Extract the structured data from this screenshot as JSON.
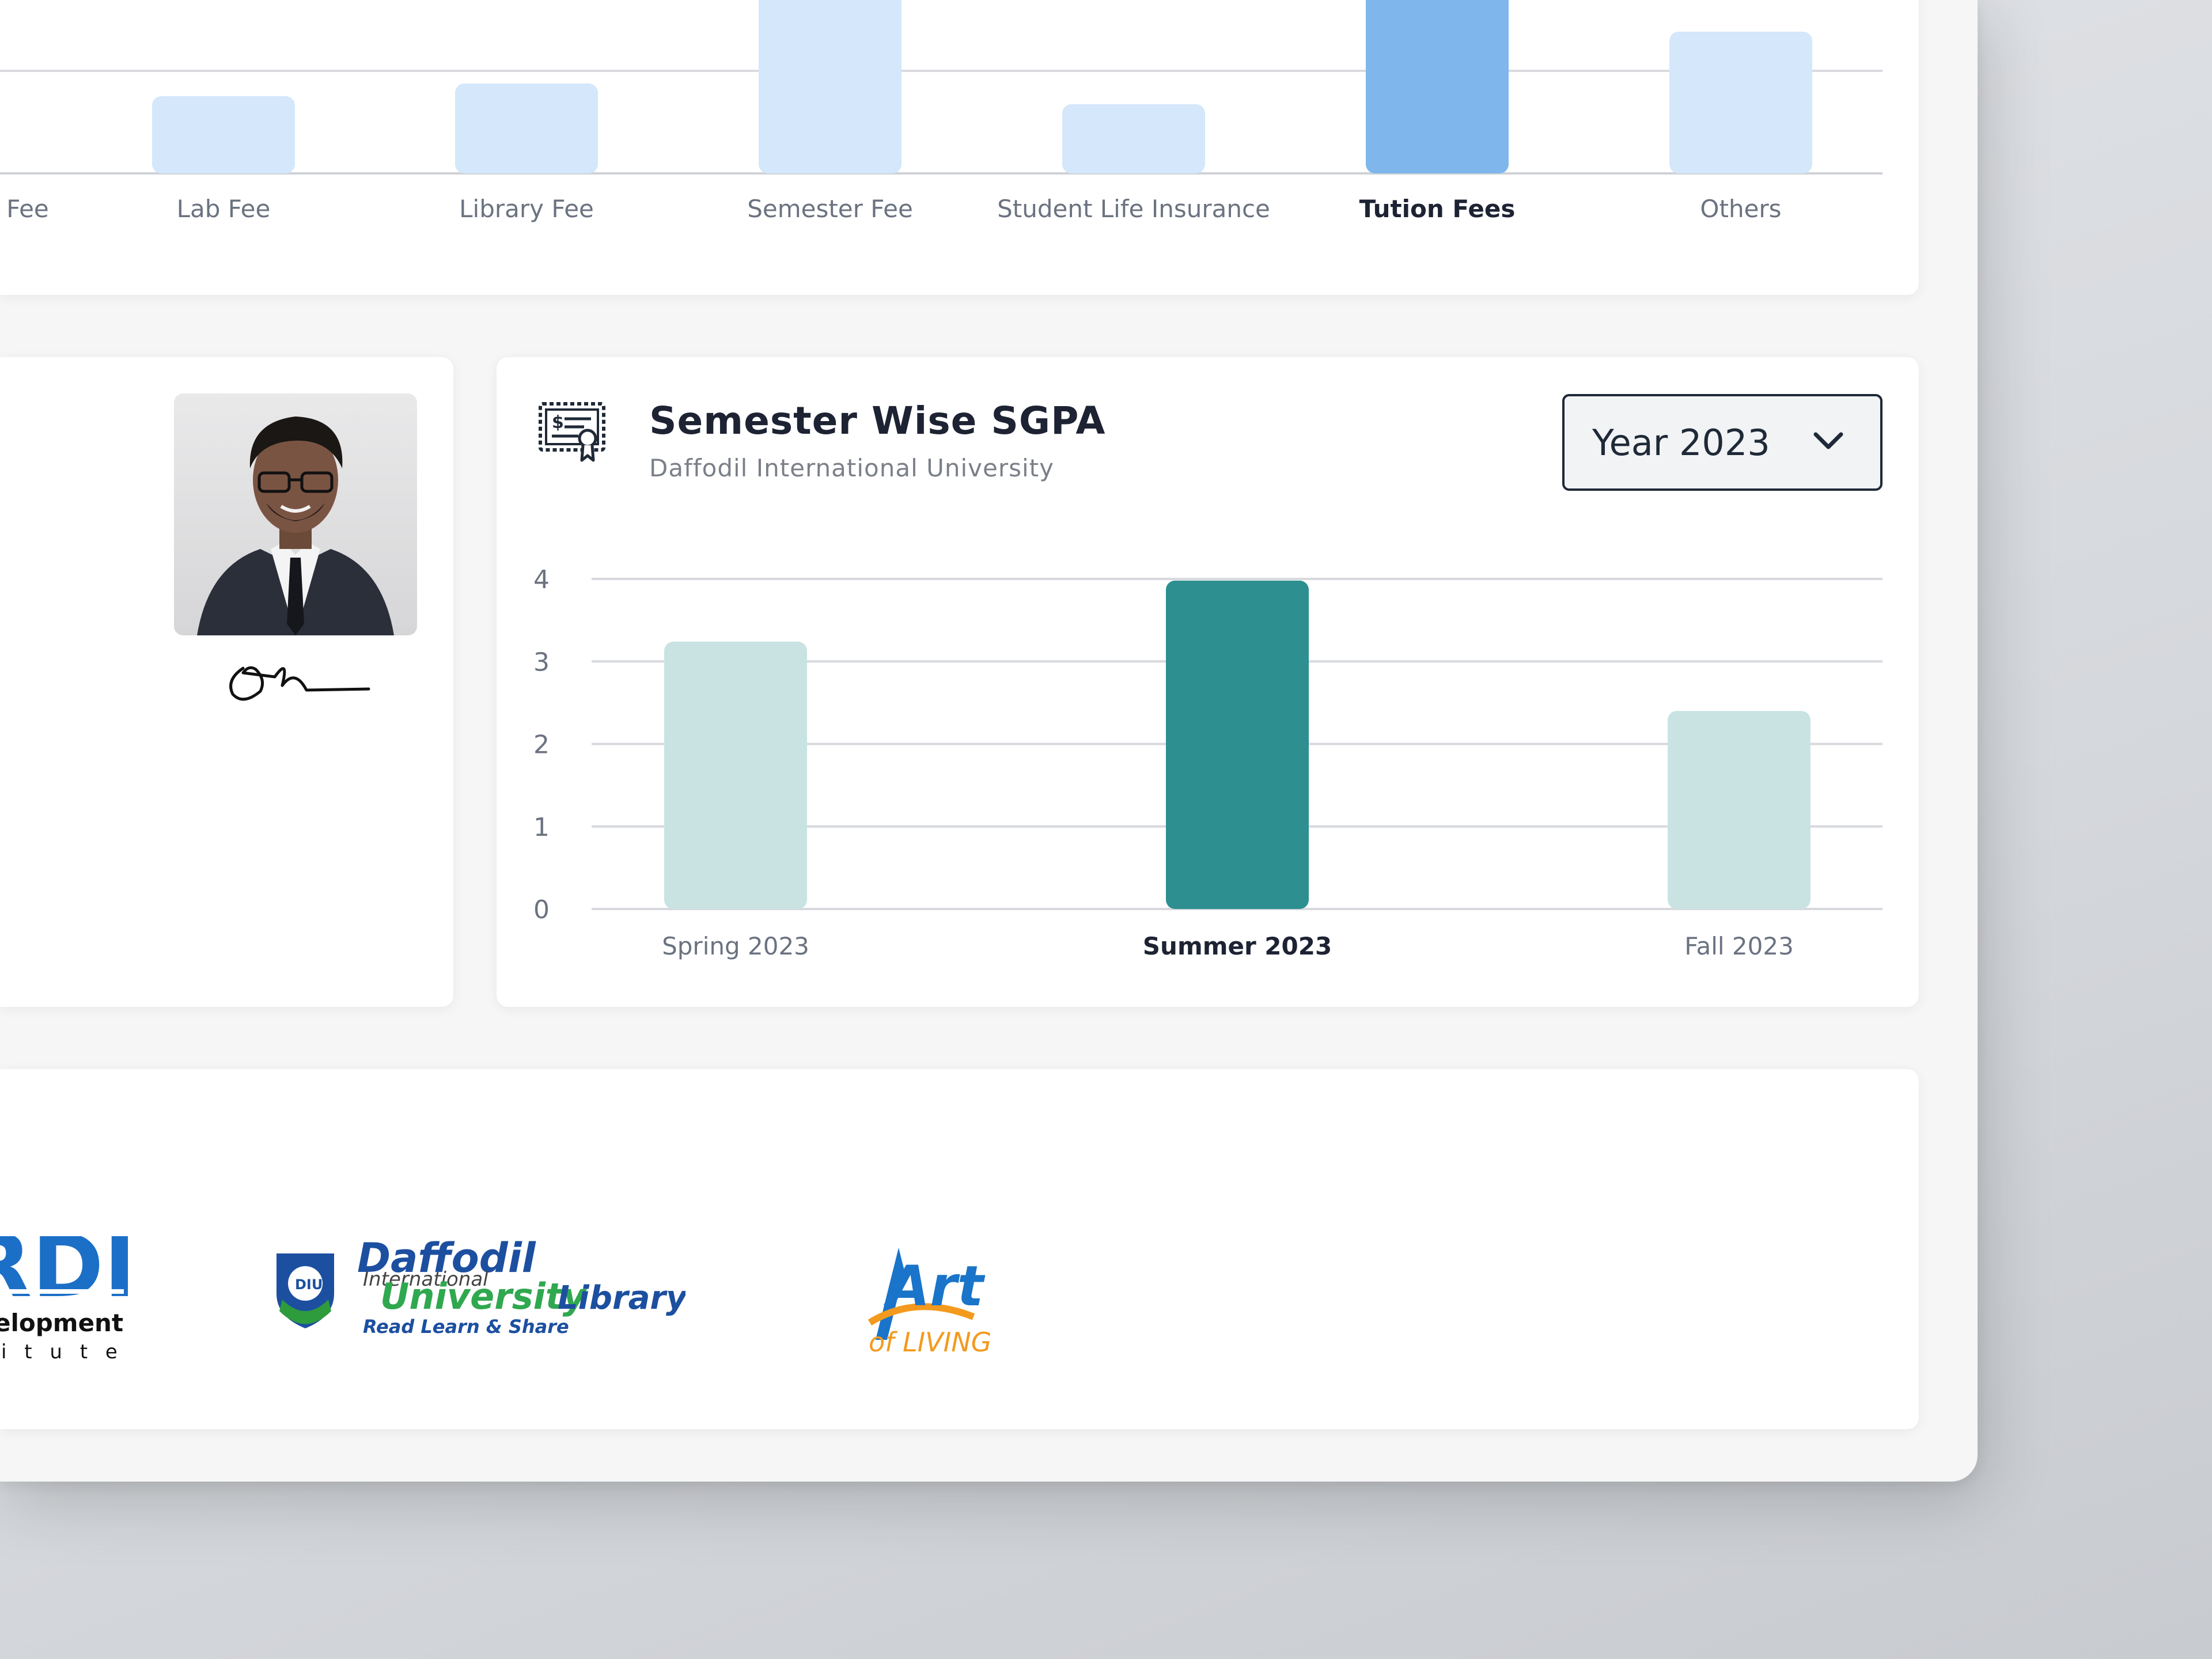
{
  "fee_chart": {
    "categories": [
      "Fee",
      "Lab Fee",
      "Library Fee",
      "Semester Fee",
      "Student Life Insurance",
      "Tution Fees",
      "Others"
    ],
    "highlighted": "Tution Fees",
    "colors": {
      "bar": "#d4e7fb",
      "bar_active": "#7fb6ec",
      "label": "#6b7280",
      "label_active": "#1d2333"
    }
  },
  "sgpa": {
    "title": "Semester Wise SGPA",
    "subtitle": "Daffodil International University",
    "icon": "certificate-icon",
    "year_select": {
      "value": "Year 2023",
      "icon": "chevron-down-icon"
    }
  },
  "chart_data": {
    "type": "bar",
    "categories": [
      "Spring 2023",
      "Summer 2023",
      "Fall 2023"
    ],
    "values": [
      3.24,
      3.98,
      2.4
    ],
    "highlighted": "Summer 2023",
    "yticks": [
      "0",
      "1",
      "2",
      "3",
      "4"
    ],
    "ylim": [
      0,
      4
    ],
    "grid": true,
    "title": "Semester Wise SGPA",
    "colors": {
      "bar": "#c9e3e3",
      "bar_active": "#2d8f8f"
    }
  },
  "profile": {
    "photo": "student-photo",
    "signature": "signature-image"
  },
  "partners": {
    "logos": [
      {
        "name": "rdi-logo",
        "text": [
          "RDI",
          "elopment",
          "i t u t e"
        ]
      },
      {
        "name": "diu-library-logo",
        "text": [
          "Daffodil",
          "International",
          "University",
          "Library",
          "Read Learn & Share"
        ]
      },
      {
        "name": "art-of-living-logo",
        "text": [
          "Art",
          "of LIVING"
        ]
      }
    ]
  }
}
